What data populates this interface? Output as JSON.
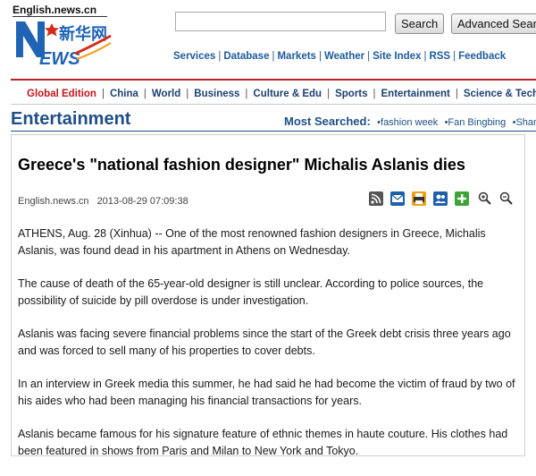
{
  "site": {
    "url": "English.news.cn",
    "logo_letters": "NEWS",
    "logo_chinese": "新华网"
  },
  "search": {
    "value": "",
    "placeholder": "",
    "search_label": "Search",
    "advanced_label": "Advanced Search"
  },
  "services": [
    "Services",
    "Database",
    "Markets",
    "Weather",
    "Site Index",
    "RSS",
    "Feedback"
  ],
  "nav": {
    "items": [
      "Global Edition",
      "China",
      "World",
      "Business",
      "Culture & Edu",
      "Sports",
      "Entertainment",
      "Science & Technology"
    ]
  },
  "section": {
    "title": "Entertainment",
    "most_searched_label": "Most Searched:",
    "most_searched": [
      "•fashion week",
      "•Fan Bingbing",
      "•Shanghai"
    ]
  },
  "article": {
    "headline": "Greece's \"national fashion designer\" Michalis Aslanis dies",
    "source": "English.news.cn",
    "date": "2013-08-29 07:09:38",
    "paragraphs": [
      "ATHENS, Aug. 28 (Xinhua) -- One of the most renowned fashion designers in Greece, Michalis Aslanis, was found dead in his apartment in Athens on Wednesday.",
      "The cause of death of the 65-year-old designer is still unclear. According to police sources, the possibility of suicide by pill overdose is under investigation.",
      "Aslanis was facing severe financial problems since the start of the Greek debt crisis three years ago and was forced to sell many of his properties to cover debts.",
      "In an interview in Greek media this summer, he had said he had become the victim of fraud by two of his aides who had been managing his financial transactions for years.",
      "Aslanis became famous for his signature feature of ethnic themes in haute couture. His clothes had been featured in shows from Paris and Milan to New York and Tokyo."
    ]
  },
  "tools": [
    {
      "icon": "rss-icon"
    },
    {
      "icon": "email-icon"
    },
    {
      "icon": "print-icon"
    },
    {
      "icon": "contact-icon"
    },
    {
      "icon": "add-icon"
    },
    {
      "icon": "zoom-in-icon"
    },
    {
      "icon": "zoom-out-icon"
    }
  ],
  "colors": {
    "brand_blue": "#1e4f86",
    "brand_red": "#c3161c",
    "link_blue": "#1e5b9c"
  }
}
